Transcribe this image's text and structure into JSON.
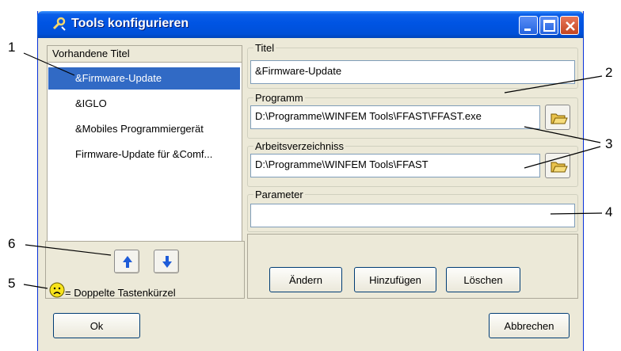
{
  "window": {
    "title": "Tools konfigurieren"
  },
  "list": {
    "header": "Vorhandene Titel",
    "items": [
      "&Firmware-Update",
      "&IGLO",
      "&Mobiles Programmiergerät",
      "Firmware-Update für &Comf..."
    ],
    "selected_index": 0
  },
  "legend": {
    "duplicate_text": "= Doppelte Tastenkürzel"
  },
  "fields": {
    "titel": {
      "label": "Titel",
      "value": "&Firmware-Update"
    },
    "programm": {
      "label": "Programm",
      "value": "D:\\Programme\\WINFEM Tools\\FFAST\\FFAST.exe"
    },
    "arbeitsverzeichnis": {
      "label": "Arbeitsverzeichniss",
      "value": "D:\\Programme\\WINFEM Tools\\FFAST"
    },
    "parameter": {
      "label": "Parameter",
      "value": ""
    }
  },
  "buttons": {
    "aendern": "Ändern",
    "hinzufuegen": "Hinzufügen",
    "loeschen": "Löschen",
    "ok": "Ok",
    "abbrechen": "Abbrechen"
  },
  "callouts": {
    "c1": "1",
    "c2": "2",
    "c3": "3",
    "c4": "4",
    "c5": "5",
    "c6": "6"
  },
  "colors": {
    "titlebar": "#0054e3",
    "selection": "#316ac5",
    "window_bg": "#ece9d8"
  }
}
